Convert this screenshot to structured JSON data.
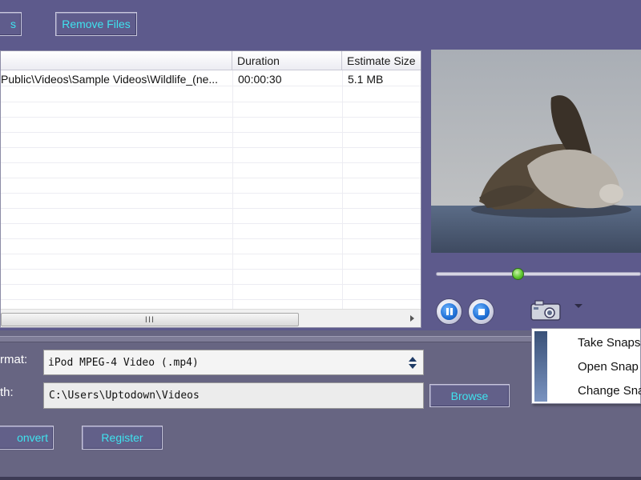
{
  "toolbar": {
    "add_files_label": "s",
    "remove_files_label": "Remove Files"
  },
  "file_list": {
    "columns": [
      "Duration",
      "Estimate Size"
    ],
    "rows": [
      {
        "path": "Public\\Videos\\Sample Videos\\Wildlife_(ne...",
        "duration": "00:00:30",
        "size": "5.1 MB"
      }
    ],
    "scroll_grip": "III"
  },
  "preview": {
    "seek_position": 0.4,
    "pause_icon": "pause-icon",
    "stop_icon": "stop-icon",
    "snapshot_icon": "camera-icon"
  },
  "snapshot_menu": {
    "items": [
      "Take Snaps",
      "Open Snap",
      "Change Sna"
    ]
  },
  "output": {
    "format_label": "rmat:",
    "format_value": "iPod MPEG-4 Video (.mp4)",
    "path_label": "th:",
    "path_value": "C:\\Users\\Uptodown\\Videos",
    "browse_label": "Browse"
  },
  "actions": {
    "convert_label": "onvert",
    "register_label": "Register"
  },
  "colors": {
    "panel": "#5d5a8c",
    "button_text": "#3fe3ef",
    "bottom_panel": "#676582"
  }
}
